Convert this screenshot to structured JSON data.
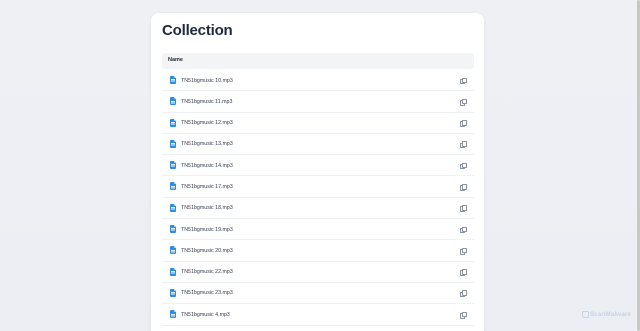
{
  "page": {
    "title": "Collection"
  },
  "table": {
    "header": "Name",
    "rows": [
      {
        "name": "TN51bgmusic 10.mp3"
      },
      {
        "name": "TN51bgmusic 11.mp3"
      },
      {
        "name": "TN51bgmusic 12.mp3"
      },
      {
        "name": "TN51bgmusic 13.mp3"
      },
      {
        "name": "TN51bgmusic 14.mp3"
      },
      {
        "name": "TN51bgmusic 17.mp3"
      },
      {
        "name": "TN51bgmusic 18.mp3"
      },
      {
        "name": "TN51bgmusic 19.mp3"
      },
      {
        "name": "TN51bgmusic 20.mp3"
      },
      {
        "name": "TN51bgmusic 22.mp3"
      },
      {
        "name": "TN51bgmusic 23.mp3"
      },
      {
        "name": "TN51bgmusic 4.mp3"
      }
    ],
    "row_icon": "file-audio-icon",
    "action_icon": "copy-icon"
  },
  "watermark": {
    "text": "ScanMalware"
  },
  "colors": {
    "accent": "#2b8fe0",
    "background": "#eef0f4",
    "card": "#ffffff"
  }
}
